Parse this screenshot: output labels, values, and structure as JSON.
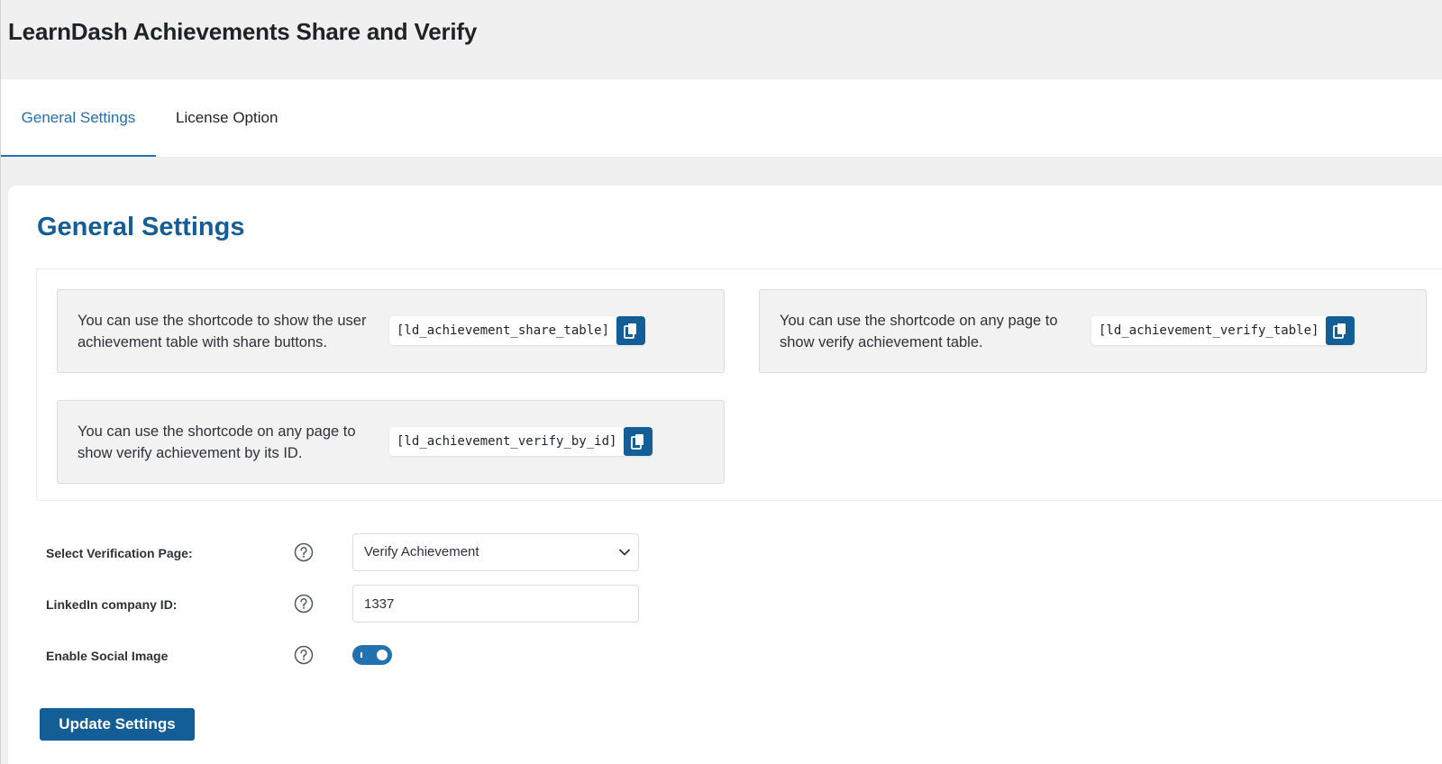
{
  "header": {
    "title": "LearnDash Achievements Share and Verify"
  },
  "tabs": [
    {
      "label": "General Settings",
      "active": true
    },
    {
      "label": "License Option",
      "active": false
    }
  ],
  "main": {
    "section_title": "General Settings",
    "shortcodes": [
      {
        "description": "You can use the shortcode to show the user achievement table with share buttons.",
        "code": "[ld_achievement_share_table]",
        "copy_icon": "copy-icon"
      },
      {
        "description": "You can use the shortcode on any page to show verify achievement table.",
        "code": "[ld_achievement_verify_table]",
        "copy_icon": "copy-icon"
      },
      {
        "description": "You can use the shortcode on any page to show verify achievement by its ID.",
        "code": "[ld_achievement_verify_by_id]",
        "copy_icon": "copy-icon"
      }
    ],
    "form": {
      "verification_page": {
        "label": "Select Verification Page:",
        "value": "Verify Achievement"
      },
      "linkedin_id": {
        "label": "LinkedIn company ID:",
        "value": "1337"
      },
      "social_image": {
        "label": "Enable Social Image",
        "enabled": true
      }
    },
    "submit_label": "Update Settings"
  },
  "colors": {
    "accent": "#2271b1",
    "brand_dark": "#135e96",
    "background": "#f0f0f1",
    "card_bg": "#f2f2f3"
  }
}
